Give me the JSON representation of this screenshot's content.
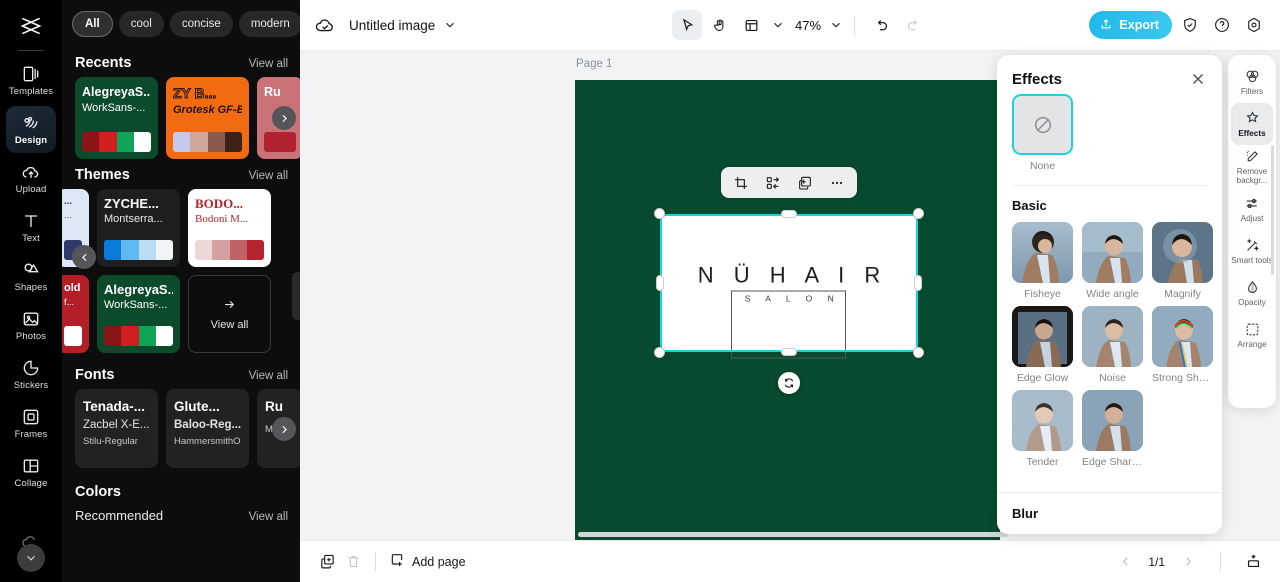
{
  "left_rail": {
    "logo_icon": "capcut-logo-icon",
    "items": [
      {
        "label": "Templates",
        "icon": "templates-icon",
        "active": false
      },
      {
        "label": "Design",
        "icon": "design-icon",
        "active": true
      },
      {
        "label": "Upload",
        "icon": "upload-cloud-icon",
        "active": false
      },
      {
        "label": "Text",
        "icon": "text-t-icon",
        "active": false
      },
      {
        "label": "Shapes",
        "icon": "shapes-icon",
        "active": false
      },
      {
        "label": "Photos",
        "icon": "photos-image-icon",
        "active": false
      },
      {
        "label": "Stickers",
        "icon": "stickers-icon",
        "active": false
      },
      {
        "label": "Frames",
        "icon": "frames-icon",
        "active": false
      },
      {
        "label": "Collage",
        "icon": "collage-icon",
        "active": false
      }
    ],
    "expand_icon": "chevron-down-icon"
  },
  "browse_panel": {
    "chips": [
      {
        "label": "All",
        "selected": true
      },
      {
        "label": "cool",
        "selected": false
      },
      {
        "label": "concise",
        "selected": false
      },
      {
        "label": "modern",
        "selected": false
      }
    ],
    "chips_more_icon": "chevron-down-icon",
    "sections": {
      "recents": {
        "title": "Recents",
        "view_all": "View all",
        "cards": [
          {
            "title": "AlegreyaS...",
            "subtitle": "WorkSans-...",
            "bg": "#0b4b2c",
            "title_color": "#ffffff",
            "sub_color": "#ffffff",
            "swatches": [
              "#8a1416",
              "#d11f1f",
              "#0fa458",
              "#ffffff"
            ]
          },
          {
            "title": "ZY B...",
            "subtitle": "Grotesk GF-B...",
            "bg": "#f26b10",
            "title_color": "#f26b10",
            "sub_color": "#231108",
            "swatches": [
              "#c6c7ed",
              "#cfa79d",
              "#8a5a4c",
              "#3b2118"
            ]
          },
          {
            "title": "Ru",
            "subtitle": "",
            "bg": "#c97378",
            "title_color": "#ffffff",
            "sub_color": "#ffffff",
            "swatches": [
              "#b32230",
              "#b32230",
              "#b32230",
              "#b32230"
            ]
          }
        ],
        "next_icon": "chevron-right-icon"
      },
      "themes": {
        "title": "Themes",
        "view_all": "View all",
        "cards": [
          {
            "title": "...",
            "subtitle": "...",
            "bg": "#dce8f5",
            "title_color": "#3a4a80",
            "sub_color": "#3a4a80",
            "swatches": [
              "#2f3a6b",
              "#2f3a6b",
              "#2f3a6b",
              "#2f3a6b"
            ]
          },
          {
            "title": "ZYCHE...",
            "subtitle": "Montserra...",
            "bg": "#1d1f1e",
            "title_color": "#ffffff",
            "sub_color": "#e8e8e8",
            "swatches": [
              "#0a7bd8",
              "#5fb9f2",
              "#bcdcf6",
              "#f2f5f7"
            ]
          },
          {
            "title": "BODO...",
            "subtitle": "Bodoni M...",
            "bg": "#ffffff",
            "title_color": "#b5242c",
            "sub_color": "#b5242c",
            "swatches": [
              "#ecd7d6",
              "#d5a0a1",
              "#bf6366",
              "#b5242c"
            ]
          },
          {
            "title": "old",
            "subtitle": "f...",
            "bg": "#b41f27",
            "title_color": "#ffffff",
            "sub_color": "#ffffff",
            "swatches": [
              "#ffffff",
              "#ffffff",
              "#ffffff",
              "#ffffff"
            ]
          },
          {
            "title": "AlegreyaS...",
            "subtitle": "WorkSans-...",
            "bg": "#0b4b2c",
            "title_color": "#ffffff",
            "sub_color": "#ffffff",
            "swatches": [
              "#8a1416",
              "#d11f1f",
              "#0fa458",
              "#ffffff"
            ]
          }
        ],
        "view_all_card": {
          "label": "View all",
          "icon": "arrow-right-icon"
        },
        "prev_icon": "chevron-left-icon"
      },
      "fonts": {
        "title": "Fonts",
        "view_all": "View all",
        "cards": [
          {
            "line1": "Tenada-...",
            "line2": "Zacbel X-E...",
            "line3": "Stilu-Regular"
          },
          {
            "line1": "Glute...",
            "line2": "Baloo-Reg...",
            "line3": "HammersmithOn..."
          },
          {
            "line1": "Ru",
            "line2": "",
            "line3": "Mor"
          }
        ],
        "next_icon": "chevron-right-icon"
      },
      "colors": {
        "title": "Colors",
        "recommended_label": "Recommended",
        "view_all": "View all"
      }
    }
  },
  "topbar": {
    "cloud_icon": "cloud-saved-icon",
    "doc_title": "Untitled image",
    "title_chevron_icon": "chevron-down-icon",
    "tools": [
      {
        "name": "select-tool",
        "icon": "cursor-arrow-icon",
        "active": true
      },
      {
        "name": "hand-tool",
        "icon": "hand-icon",
        "active": false
      },
      {
        "name": "layout-tool",
        "icon": "layout-grid-icon",
        "active": false
      }
    ],
    "layout_chevron_icon": "chevron-down-icon",
    "zoom_level": "47%",
    "zoom_chevron_icon": "chevron-down-icon",
    "undo_icon": "undo-arrow-icon",
    "redo_icon": "redo-arrow-icon",
    "export_label": "Export",
    "export_icon": "share-upload-icon",
    "export_color": "#2cbfea",
    "right_icons": [
      {
        "name": "shield-check-icon"
      },
      {
        "name": "help-question-icon"
      },
      {
        "name": "settings-gear-icon"
      }
    ]
  },
  "canvas": {
    "page_label": "Page 1",
    "page_tools": [
      {
        "name": "duplicate-page-icon"
      },
      {
        "name": "more-options-icon"
      }
    ],
    "background_color": "#084a2d",
    "selection": {
      "border_color": "#0fd8e0",
      "rotate_icon": "rotate-icon",
      "float_toolbar": [
        {
          "name": "crop-icon"
        },
        {
          "name": "match-replace-icon"
        },
        {
          "name": "duplicate-icon"
        },
        {
          "name": "more-options-icon"
        }
      ]
    },
    "artwork": {
      "title": "N Ü H A I R",
      "subtitle": "S A L O N"
    }
  },
  "bottombar": {
    "duplicate_icon": "duplicate-page-icon",
    "delete_icon": "trash-icon",
    "add_page_label": "Add page",
    "add_page_icon": "add-page-icon",
    "prev_icon": "chevron-left-icon",
    "page_indicator": "1/1",
    "next_icon": "chevron-right-icon",
    "present_icon": "present-icon"
  },
  "effects_panel": {
    "title": "Effects",
    "close_icon": "close-x-icon",
    "none": {
      "label": "None",
      "icon": "no-effect-icon",
      "selected": true,
      "accent": "#19d3d8"
    },
    "basic_title": "Basic",
    "basic_effects": [
      {
        "label": "Fisheye"
      },
      {
        "label": "Wide angle"
      },
      {
        "label": "Magnify"
      },
      {
        "label": "Edge Glow"
      },
      {
        "label": "Noise"
      },
      {
        "label": "Strong Shar..."
      },
      {
        "label": "Tender"
      },
      {
        "label": "Edge Sharp..."
      }
    ],
    "blur_title": "Blur"
  },
  "right_rail": {
    "items": [
      {
        "label": "Filters",
        "icon": "filters-icon",
        "active": false
      },
      {
        "label": "Effects",
        "icon": "effects-sparkle-icon",
        "active": true
      },
      {
        "label": "Remove backgr...",
        "icon": "remove-background-icon",
        "active": false
      },
      {
        "label": "Adjust",
        "icon": "adjust-sliders-icon",
        "active": false
      },
      {
        "label": "Smart tools",
        "icon": "smart-tools-wand-icon",
        "active": false
      },
      {
        "label": "Opacity",
        "icon": "opacity-drop-icon",
        "active": false
      },
      {
        "label": "Arrange",
        "icon": "arrange-icon",
        "active": false
      }
    ]
  }
}
